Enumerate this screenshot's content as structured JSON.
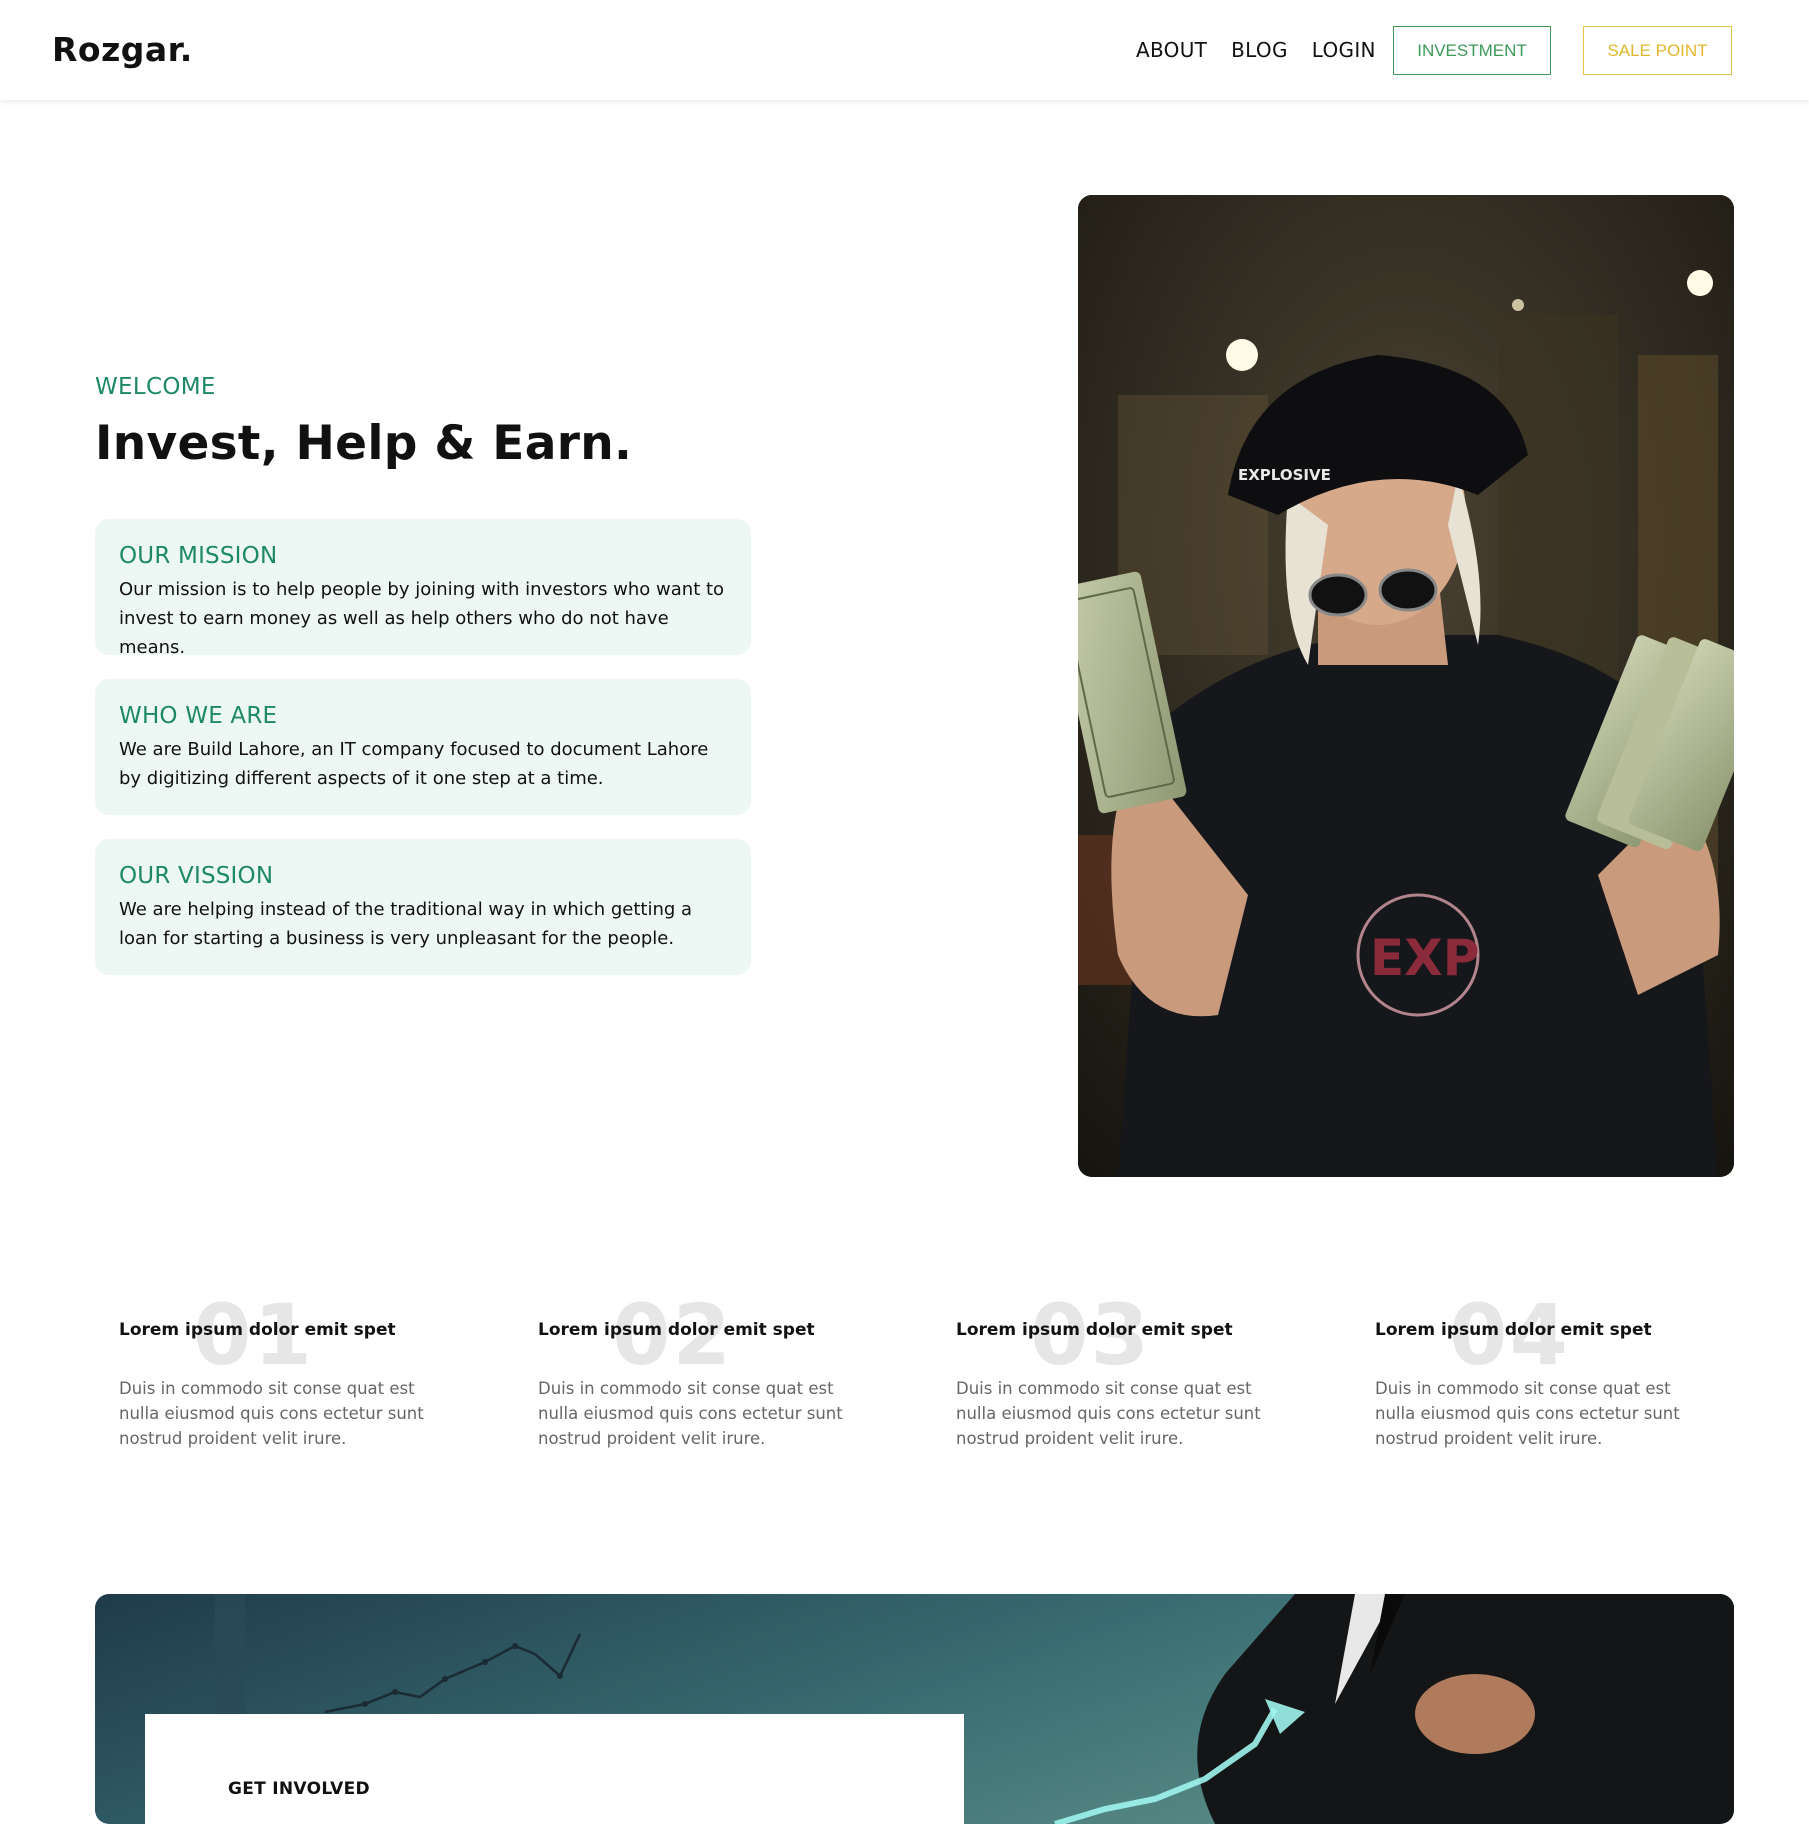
{
  "brand": {
    "logo": "Rozgar."
  },
  "nav": {
    "links": [
      "ABOUT",
      "BLOG",
      "LOGIN"
    ],
    "investment_button": "INVESTMENT",
    "sale_point_button": "SALE POINT"
  },
  "hero": {
    "welcome": "WELCOME",
    "title": "Invest, Help & Earn.",
    "cards": [
      {
        "title": "OUR MISSION",
        "text": "Our mission is to help people by joining with investors who want to invest to earn money as well as help others who do not have means."
      },
      {
        "title": "WHO WE ARE",
        "text": "We are Build Lahore, an IT company focused to document Lahore by digitizing different aspects of it one step at a time."
      },
      {
        "title": "OUR VISSION",
        "text": "We are helping instead of the traditional way in which getting a loan for starting a business is very unpleasant for the people."
      }
    ]
  },
  "steps": [
    {
      "number": "01",
      "title": "Lorem ipsum dolor emit spet",
      "text": "Duis in commodo sit conse quat est nulla eiusmod quis cons ectetur sunt nostrud proident velit irure."
    },
    {
      "number": "02",
      "title": "Lorem ipsum dolor emit spet",
      "text": "Duis in commodo sit conse quat est nulla eiusmod quis cons ectetur sunt nostrud proident velit irure."
    },
    {
      "number": "03",
      "title": "Lorem ipsum dolor emit spet",
      "text": "Duis in commodo sit conse quat est nulla eiusmod quis cons ectetur sunt nostrud proident velit irure."
    },
    {
      "number": "04",
      "title": "Lorem ipsum dolor emit spet",
      "text": "Duis in commodo sit conse quat est nulla eiusmod quis cons ectetur sunt nostrud proident velit irure."
    }
  ],
  "get_involved": {
    "label": "GET INVOLVED"
  },
  "colors": {
    "accent_green": "#1e8a64",
    "investment_button": "#3d9a58",
    "sale_point_button": "#e0b82c",
    "card_background": "#edf7f3"
  }
}
